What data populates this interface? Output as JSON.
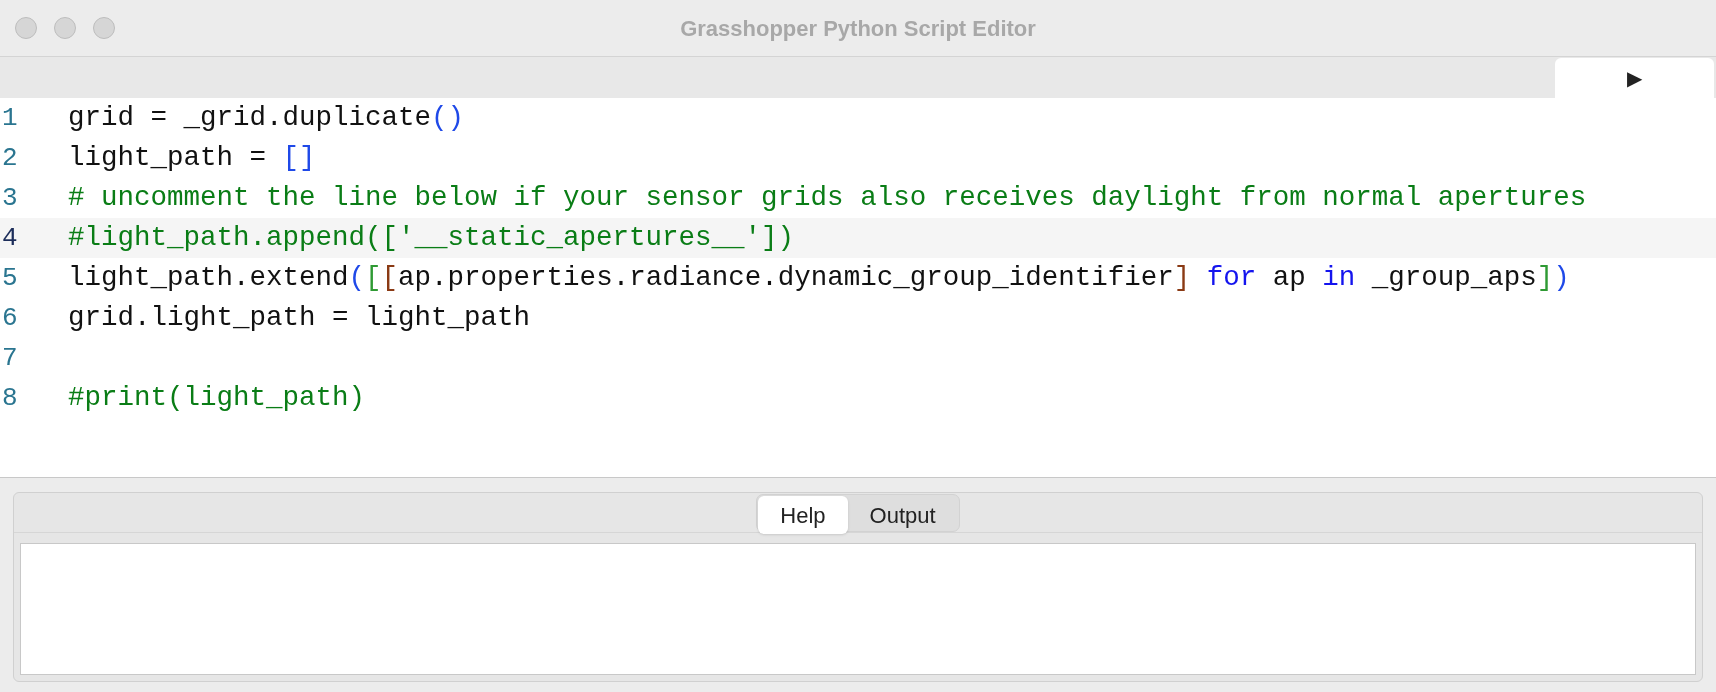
{
  "window": {
    "title": "Grasshopper Python Script Editor"
  },
  "toolbar": {
    "run_button": "▶"
  },
  "editor": {
    "lines": [
      {
        "number": "1",
        "current": false,
        "tokens": [
          {
            "kind": "plain",
            "text": "grid = _grid.duplicate"
          },
          {
            "kind": "bracket1",
            "text": "()"
          }
        ]
      },
      {
        "number": "2",
        "current": false,
        "tokens": [
          {
            "kind": "plain",
            "text": "light_path = "
          },
          {
            "kind": "bracket1",
            "text": "[]"
          }
        ]
      },
      {
        "number": "3",
        "current": false,
        "tokens": [
          {
            "kind": "comment",
            "text": "# uncomment the line below if your sensor grids also receives daylight from normal apertures"
          }
        ]
      },
      {
        "number": "4",
        "current": true,
        "tokens": [
          {
            "kind": "comment",
            "text": "#light_path.append(['__static_apertures__'])"
          }
        ]
      },
      {
        "number": "5",
        "current": false,
        "tokens": [
          {
            "kind": "plain",
            "text": "light_path.extend"
          },
          {
            "kind": "bracket1",
            "text": "("
          },
          {
            "kind": "bracket2",
            "text": "["
          },
          {
            "kind": "bracket3",
            "text": "["
          },
          {
            "kind": "plain",
            "text": "ap.properties.radiance.dynamic_group_identifier"
          },
          {
            "kind": "bracket3",
            "text": "]"
          },
          {
            "kind": "keyword",
            "text": " for"
          },
          {
            "kind": "plain",
            "text": " ap "
          },
          {
            "kind": "keyword",
            "text": "in"
          },
          {
            "kind": "plain",
            "text": " _group_aps"
          },
          {
            "kind": "bracket2",
            "text": "]"
          },
          {
            "kind": "bracket1",
            "text": ")"
          }
        ]
      },
      {
        "number": "6",
        "current": false,
        "tokens": [
          {
            "kind": "plain",
            "text": "grid.light_path = light_path"
          }
        ]
      },
      {
        "number": "7",
        "current": false
      },
      {
        "number": "8",
        "current": false,
        "tokens": [
          {
            "kind": "comment",
            "text": "#print(light_path)"
          }
        ]
      }
    ]
  },
  "tabs": [
    {
      "label": "Help",
      "selected": true
    },
    {
      "label": "Output",
      "selected": false
    }
  ]
}
